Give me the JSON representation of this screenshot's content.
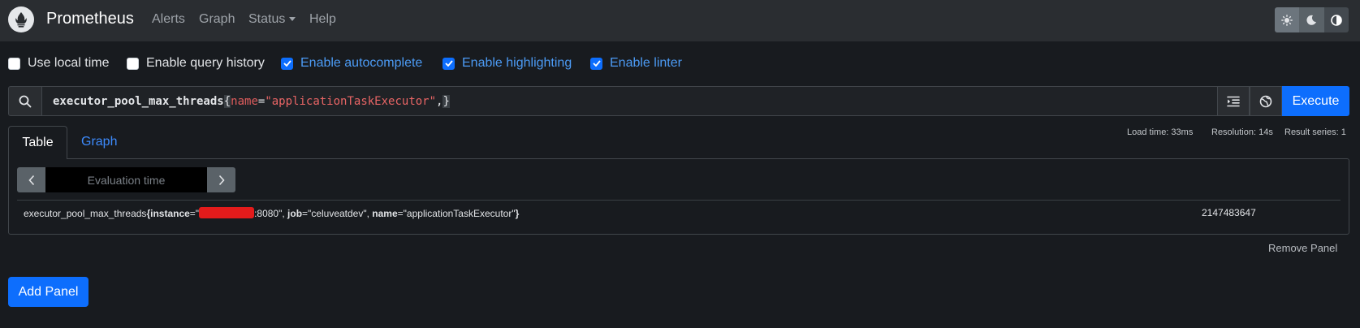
{
  "navbar": {
    "brand": "Prometheus",
    "links": {
      "alerts": "Alerts",
      "graph": "Graph",
      "status": "Status",
      "help": "Help"
    },
    "theme_icons": [
      "sun-icon",
      "moon-icon",
      "half-circle-icon"
    ]
  },
  "options": {
    "use_local_time": {
      "label": "Use local time",
      "checked": false
    },
    "enable_query_history": {
      "label": "Enable query history",
      "checked": false
    },
    "enable_autocomplete": {
      "label": "Enable autocomplete",
      "checked": true
    },
    "enable_highlighting": {
      "label": "Enable highlighting",
      "checked": true
    },
    "enable_linter": {
      "label": "Enable linter",
      "checked": true
    }
  },
  "expression": {
    "metric": "executor_pool_max_threads",
    "open_brace": "{",
    "label_name": "name",
    "operator": "=",
    "label_value": "\"applicationTaskExecutor\"",
    "trailing": ",",
    "close_brace": "}",
    "execute_label": "Execute"
  },
  "tabs": {
    "table": "Table",
    "graph": "Graph"
  },
  "stats": {
    "load_time": "Load time: 33ms",
    "resolution": "Resolution: 14s",
    "result_series": "Result series: 1"
  },
  "panel": {
    "evaluation_placeholder": "Evaluation time",
    "result": {
      "metric": "executor_pool_max_threads",
      "brace_open": "{",
      "instance_key": "instance",
      "instance_prefix": "=\"",
      "instance_suffix": ":8080\", ",
      "job_key": "job",
      "job_value": "=\"celuveatdev\", ",
      "name_key": "name",
      "name_value": "=\"applicationTaskExecutor\"",
      "brace_close": "}",
      "value": "2147483647"
    }
  },
  "remove_panel": "Remove Panel",
  "add_panel": "Add Panel",
  "colors": {
    "accent": "#0d6efd",
    "background": "#181b1f",
    "navbar": "#2a2d31",
    "redaction": "#e31b1b"
  }
}
